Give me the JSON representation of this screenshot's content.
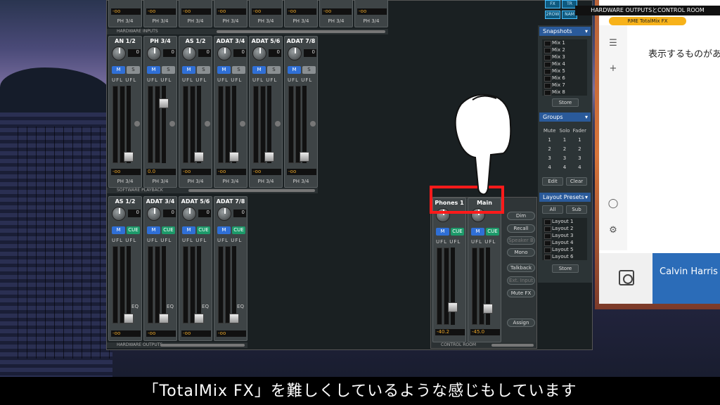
{
  "subtitle": "「TotalMix FX」を難しくしているような感じもしています",
  "app": {
    "title": "HARDWARE OUTPUTSとCONTROL ROOM",
    "subtitle": "RME TotalMix FX",
    "message": "表示するものがあ",
    "footer": "Calvin Harris -"
  },
  "top_strip": {
    "labels": [
      "PH 3/4",
      "PH 3/4",
      "PH 3/4",
      "PH 3/4",
      "PH 3/4",
      "PH 3/4",
      "PH 3/4",
      "PH 3/4"
    ],
    "value": "-oo"
  },
  "section_labels": {
    "hardware_inputs": "HARDWARE INPUTS",
    "software_playback": "SOFTWARE PLAYBACK",
    "hardware_outputs": "HARDWARE OUTPUTS",
    "control_room": "CONTROL ROOM"
  },
  "inputs": [
    {
      "name": "AN 1/2",
      "value": "0",
      "bottom": "-oo",
      "route": "PH 3/4"
    },
    {
      "name": "PH 3/4",
      "value": "0",
      "bottom": "0.0",
      "route": "PH 3/4"
    },
    {
      "name": "AS 1/2",
      "value": "0",
      "bottom": "-oo",
      "route": "PH 3/4"
    },
    {
      "name": "ADAT 3/4",
      "value": "0",
      "bottom": "-oo",
      "route": "PH 3/4"
    },
    {
      "name": "ADAT 5/6",
      "value": "0",
      "bottom": "-oo",
      "route": "PH 3/4"
    },
    {
      "name": "ADAT 7/8",
      "value": "0",
      "bottom": "-oo",
      "route": "PH 3/4"
    }
  ],
  "outputs": [
    {
      "name": "AS 1/2",
      "value": "0",
      "bottom": "-oo"
    },
    {
      "name": "ADAT 3/4",
      "value": "0",
      "bottom": "-oo"
    },
    {
      "name": "ADAT 5/6",
      "value": "0",
      "bottom": "-oo"
    },
    {
      "name": "ADAT 7/8",
      "value": "0",
      "bottom": "-oo"
    }
  ],
  "control_room": {
    "phones_label": "Phones 1",
    "main_label": "Main",
    "phones_level": "-40.2",
    "main_level": "-45.0",
    "buttons": [
      "Dim",
      "Recall",
      "Speaker B",
      "Mono",
      "Talkback",
      "Ext. Input",
      "Mute FX",
      "Assign"
    ]
  },
  "buttons": {
    "m": "M",
    "s": "S",
    "cue": "CUE",
    "ufl": "UFL UFL",
    "eq": "EQ"
  },
  "snapshots": {
    "title": "Snapshots",
    "items": [
      "Mix 1",
      "Mix 2",
      "Mix 3",
      "Mix 4",
      "Mix 5",
      "Mix 6",
      "Mix 7",
      "Mix 8"
    ],
    "store": "Store"
  },
  "groups": {
    "title": "Groups",
    "headers": [
      "Mute",
      "Solo",
      "Fader"
    ],
    "rows": [
      [
        "1",
        "1",
        "1"
      ],
      [
        "2",
        "2",
        "2"
      ],
      [
        "3",
        "3",
        "3"
      ],
      [
        "4",
        "4",
        "4"
      ]
    ],
    "edit": "Edit",
    "clear": "Clear"
  },
  "layouts": {
    "title": "Layout Presets",
    "all": "All",
    "sub": "Sub",
    "items": [
      "Layout 1",
      "Layout 2",
      "Layout 3",
      "Layout 4",
      "Layout 5",
      "Layout 6"
    ],
    "store": "Store"
  },
  "top_buttons": [
    "FX",
    "TR",
    "2ROW",
    "NAM"
  ]
}
